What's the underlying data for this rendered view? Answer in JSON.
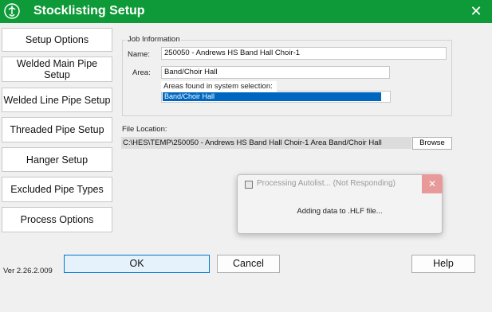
{
  "window": {
    "title": "Stocklisting Setup",
    "accent_color": "#0e9a38",
    "icon": "app-logo-icon",
    "close_icon": "close-icon"
  },
  "sidebar": {
    "items": [
      {
        "label": "Setup Options"
      },
      {
        "label": "Welded Main Pipe Setup"
      },
      {
        "label": "Welded Line Pipe Setup"
      },
      {
        "label": "Threaded Pipe Setup"
      },
      {
        "label": "Hanger Setup"
      },
      {
        "label": "Excluded Pipe Types"
      },
      {
        "label": "Process Options"
      }
    ]
  },
  "job_info": {
    "group_label": "Job Information",
    "name_label": "Name:",
    "name_value": "250050 - Andrews HS Band Hall Choir-1",
    "area_label": "Area:",
    "area_value": "Band/Choir Hall",
    "areas_tooltip": "Areas found in system selection:",
    "areas_list": [
      "Band/Choir Hall"
    ]
  },
  "file_location": {
    "label": "File Location:",
    "path": "C:\\HES\\TEMP\\250050 - Andrews HS Band Hall Choir-1 Area Band/Choir Hall",
    "browse_label": "Browse"
  },
  "processing_dialog": {
    "title": "Processing Autolist... (Not Responding)",
    "message": "Adding data to .HLF file...",
    "close_icon": "close-icon"
  },
  "footer": {
    "version": "Ver 2.26.2.009",
    "ok_label": "OK",
    "cancel_label": "Cancel",
    "help_label": "Help"
  }
}
